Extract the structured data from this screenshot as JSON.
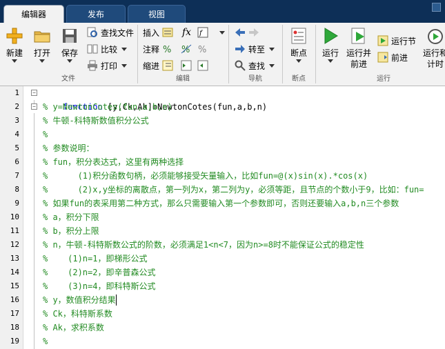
{
  "tabs": [
    {
      "label": "编辑器",
      "active": true
    },
    {
      "label": "发布",
      "active": false
    },
    {
      "label": "视图",
      "active": false
    }
  ],
  "ribbon": {
    "file": {
      "new": "新建",
      "open": "打开",
      "save": "保存",
      "find_files": "查找文件",
      "compare": "比较",
      "print": "打印",
      "group": "文件"
    },
    "edit": {
      "insert": "插入",
      "comment": "注释",
      "indent": "缩进",
      "fx": "fx",
      "group": "编辑"
    },
    "navigate": {
      "goto": "转至",
      "find": "查找",
      "group": "导航"
    },
    "breakpoints": {
      "breakpoints": "断点",
      "group": "断点"
    },
    "run": {
      "run": "运行",
      "run_advance_line1": "运行并",
      "run_advance_line2": "前进",
      "run_section": "运行节",
      "advance": "前进",
      "run_time_line1": "运行和",
      "run_time_line2": "计时",
      "group": "运行"
    }
  },
  "editor": {
    "line_numbers": [
      "1",
      "2",
      "3",
      "4",
      "5",
      "6",
      "7",
      "8",
      "9",
      "10",
      "11",
      "12",
      "13",
      "14",
      "15",
      "16",
      "17",
      "18",
      "19"
    ],
    "line1_keyword": "function",
    "line1_rest": " [y,Ck,Ak]=NewtonCotes(fun,a,b,n)",
    "lines": [
      "% y=NewtonCotes(fun,a,b,n)",
      "% 牛顿-科特斯数值积分公式",
      "%",
      "% 参数说明：",
      "% fun，积分表达式，这里有两种选择",
      "%      (1)积分函数句柄，必须能够接受矢量输入，比如fun=@(x)sin(x).*cos(x)",
      "%      (2)x,y坐标的离散点，第一列为x，第二列为y，必须等距，且节点的个数小于9，比如：fun=",
      "% 如果fun的表采用第二种方式，那么只需要输入第一个参数即可，否则还要输入a,b,n三个参数",
      "% a，积分下限",
      "% b，积分上限",
      "% n，牛顿-科特斯数公式的阶数，必须满足1<n<7，因为n>=8时不能保证公式的稳定性",
      "%    (1)n=1，即梯形公式",
      "%    (2)n=2，即辛普森公式",
      "%    (3)n=4，即科特斯公式",
      "% y，数值积分结果",
      "% Ck，科特斯系数",
      "% Ak，求积系数",
      "%"
    ]
  },
  "colors": {
    "tabbar": "#0d2f57",
    "keyword": "#0000ff",
    "comment": "#228b22"
  }
}
